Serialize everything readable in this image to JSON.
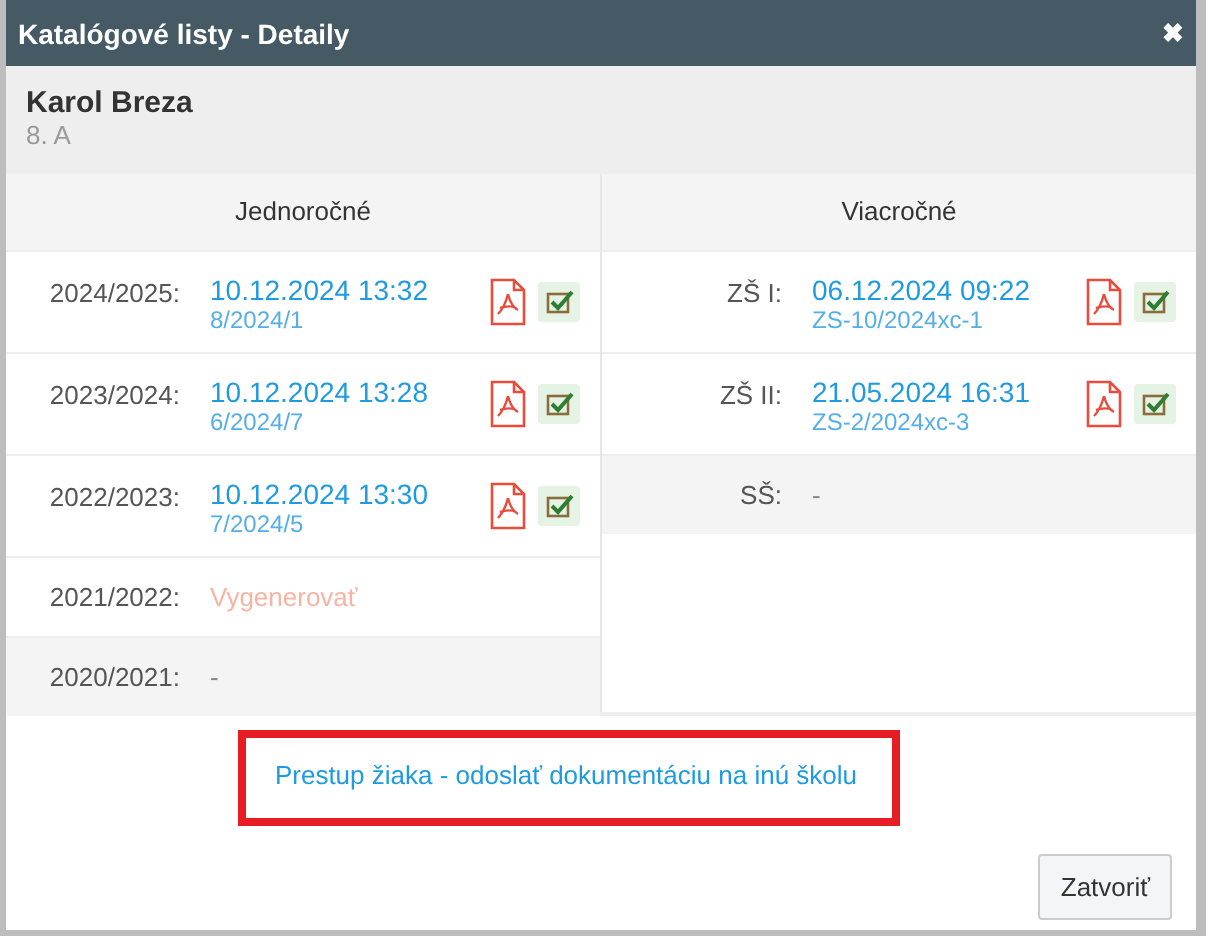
{
  "window": {
    "title": "Katalógové listy - Detaily",
    "close": "✖"
  },
  "student": {
    "name": "Karol Breza",
    "class": "8. A"
  },
  "columns": [
    {
      "title": "Jednoročné",
      "rows": [
        {
          "kind": "document",
          "label": "2024/2025:",
          "date": "10.12.2024 13:32",
          "number": "8/2024/1"
        },
        {
          "kind": "document",
          "label": "2023/2024:",
          "date": "10.12.2024 13:28",
          "number": "6/2024/7"
        },
        {
          "kind": "document",
          "label": "2022/2023:",
          "date": "10.12.2024 13:30",
          "number": "7/2024/5"
        },
        {
          "kind": "generate",
          "label": "2021/2022:",
          "action": "Vygenerovať"
        },
        {
          "kind": "empty",
          "label": "2020/2021:",
          "value": "-"
        }
      ]
    },
    {
      "title": "Viacročné",
      "rows": [
        {
          "kind": "document",
          "label": "ZŠ I:",
          "date": "06.12.2024 09:22",
          "number": "ZS-10/2024xc-1"
        },
        {
          "kind": "document",
          "label": "ZŠ II:",
          "date": "21.05.2024 16:31",
          "number": "ZS-2/2024xc-3"
        },
        {
          "kind": "empty",
          "label": "SŠ:",
          "value": "-"
        }
      ]
    }
  ],
  "transfer_link": {
    "text": "Prestup žiaka - odoslať dokumentáciu na inú školu",
    "highlighted": true
  },
  "buttons": [
    "Zatvoriť"
  ]
}
